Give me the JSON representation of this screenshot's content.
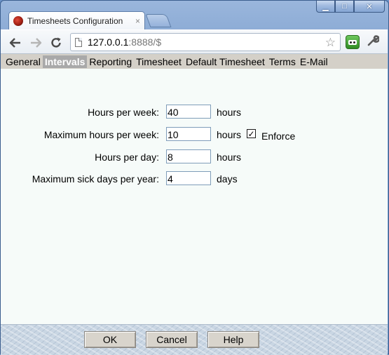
{
  "browser": {
    "tab_title": "Timesheets Configuration",
    "tab_close": "×",
    "url_host": "127.0.0.1",
    "url_rest": ":8888/$"
  },
  "window_controls": {
    "minimize": "▁",
    "maximize": "□",
    "close": "✕"
  },
  "menu": {
    "items": [
      {
        "label": "General",
        "active": false
      },
      {
        "label": "Intervals",
        "active": true
      },
      {
        "label": "Reporting",
        "active": false
      },
      {
        "label": "Timesheet",
        "active": false
      },
      {
        "label": "Default Timesheet",
        "active": false
      },
      {
        "label": "Terms",
        "active": false
      },
      {
        "label": "E-Mail",
        "active": false
      }
    ]
  },
  "form": {
    "hours_per_week": {
      "label": "Hours per week:",
      "value": "40",
      "unit": "hours"
    },
    "max_hours_per_week": {
      "label": "Maximum hours per week:",
      "value": "10",
      "unit": "hours",
      "enforce_label": "Enforce",
      "enforce_checked": true,
      "check_mark": "✓"
    },
    "hours_per_day": {
      "label": "Hours per day:",
      "value": "8",
      "unit": "hours"
    },
    "max_sick_days": {
      "label": "Maximum sick days per year:",
      "value": "4",
      "unit": "days"
    }
  },
  "buttons": {
    "ok": "OK",
    "cancel": "Cancel",
    "help": "Help"
  },
  "icons": {
    "back": "back-arrow-icon",
    "forward": "forward-arrow-icon",
    "reload": "reload-icon",
    "star": "bookmark-star-icon",
    "extension": "robot-extension-icon",
    "menu": "wrench-icon"
  }
}
